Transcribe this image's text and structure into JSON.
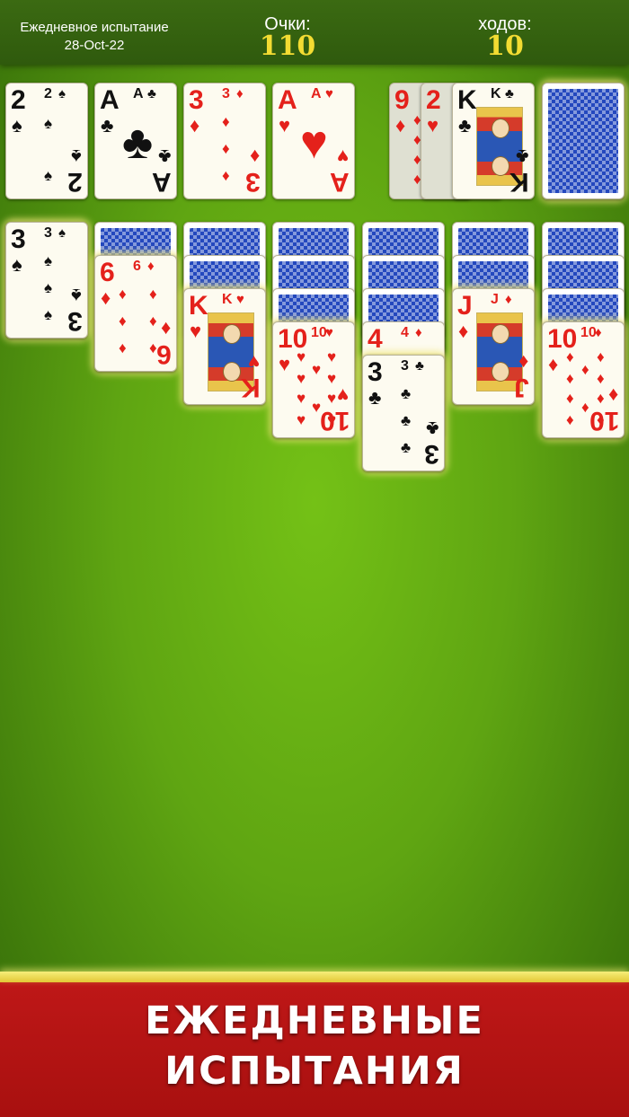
{
  "header": {
    "mode_label": "Ежедневное испытание",
    "date": "28-Oct-22",
    "score_label": "Очки:",
    "score_value": "110",
    "moves_label": "ходов:",
    "moves_value": "10"
  },
  "foundations": [
    {
      "rank": "2",
      "suit": "♠",
      "color": "#111111"
    },
    {
      "rank": "A",
      "suit": "♣",
      "color": "#111111"
    },
    {
      "rank": "3",
      "suit": "♦",
      "color": "#e4211b"
    },
    {
      "rank": "A",
      "suit": "♥",
      "color": "#e4211b"
    }
  ],
  "waste": [
    {
      "rank": "9",
      "suit": "♦",
      "color": "#e4211b"
    },
    {
      "rank": "2",
      "suit": "♥",
      "color": "#e4211b"
    },
    {
      "rank": "K",
      "suit": "♣",
      "color": "#111111"
    }
  ],
  "stock": {
    "face": "down"
  },
  "tableau": [
    {
      "hidden": 0,
      "cards": [
        {
          "rank": "3",
          "suit": "♠",
          "color": "#111111"
        }
      ]
    },
    {
      "hidden": 1,
      "cards": [
        {
          "rank": "6",
          "suit": "♦",
          "color": "#e4211b"
        }
      ]
    },
    {
      "hidden": 2,
      "cards": [
        {
          "rank": "K",
          "suit": "♥",
          "color": "#e4211b"
        }
      ]
    },
    {
      "hidden": 3,
      "cards": [
        {
          "rank": "10",
          "suit": "♥",
          "color": "#e4211b"
        }
      ]
    },
    {
      "hidden": 3,
      "cards": [
        {
          "rank": "4",
          "suit": "♦",
          "color": "#e4211b"
        },
        {
          "rank": "3",
          "suit": "♣",
          "color": "#111111"
        }
      ]
    },
    {
      "hidden": 2,
      "cards": [
        {
          "rank": "J",
          "suit": "♦",
          "color": "#e4211b"
        }
      ]
    },
    {
      "hidden": 3,
      "cards": [
        {
          "rank": "10",
          "suit": "♦",
          "color": "#e4211b"
        }
      ]
    }
  ],
  "banner": {
    "line1": "ЕЖЕДНЕВНЫЕ",
    "line2": "ИСПЫТАНИЯ"
  }
}
